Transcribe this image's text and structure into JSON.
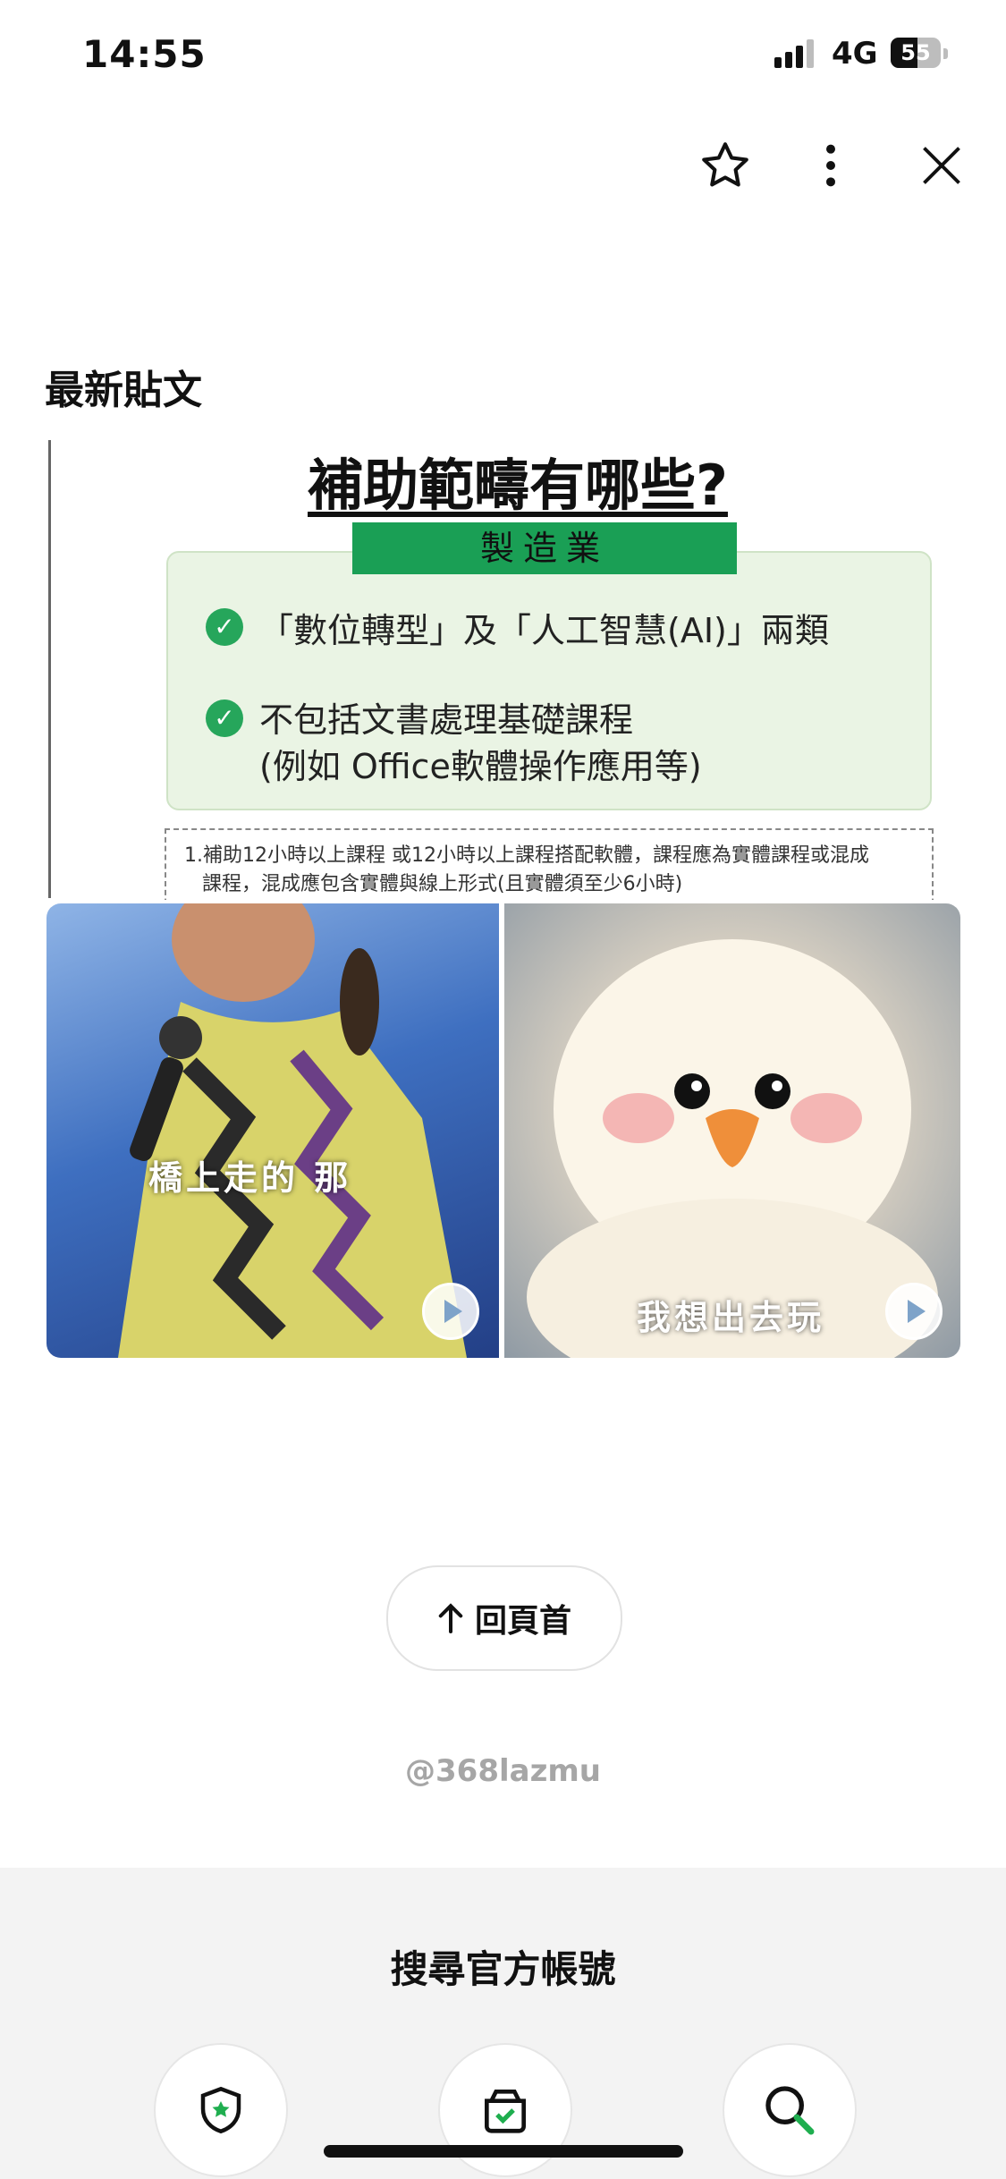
{
  "status_bar": {
    "time": "14:55",
    "network": "4G",
    "battery": "55"
  },
  "top_actions": {
    "favorite": "star-icon",
    "more": "more-vertical-icon",
    "close": "close-icon"
  },
  "section_title": "最新貼文",
  "post": {
    "heading": "補助範疇有哪些?",
    "badge": "製造業",
    "item1": "「數位轉型」及「人工智慧(AI)」兩類",
    "item2_line1": "不包括文書處理基礎課程",
    "item2_line2": "(例如 Office軟體操作應用等)",
    "note_line1": "1.補助12小時以上課程 或12小時以上課程搭配軟體，課程應為實體課程或混成",
    "note_line2": "課程，混成應包含實體與線上形式(且實體須至少6小時)"
  },
  "videos": [
    {
      "caption": "橋上走的 那"
    },
    {
      "caption": "我想出去玩"
    }
  ],
  "back_to_top": "回頁首",
  "account_handle": "@368lazmu",
  "bottom_panel": {
    "title": "搜尋官方帳號",
    "icons": [
      "shield-star-icon",
      "box-check-icon",
      "search-icon"
    ]
  }
}
